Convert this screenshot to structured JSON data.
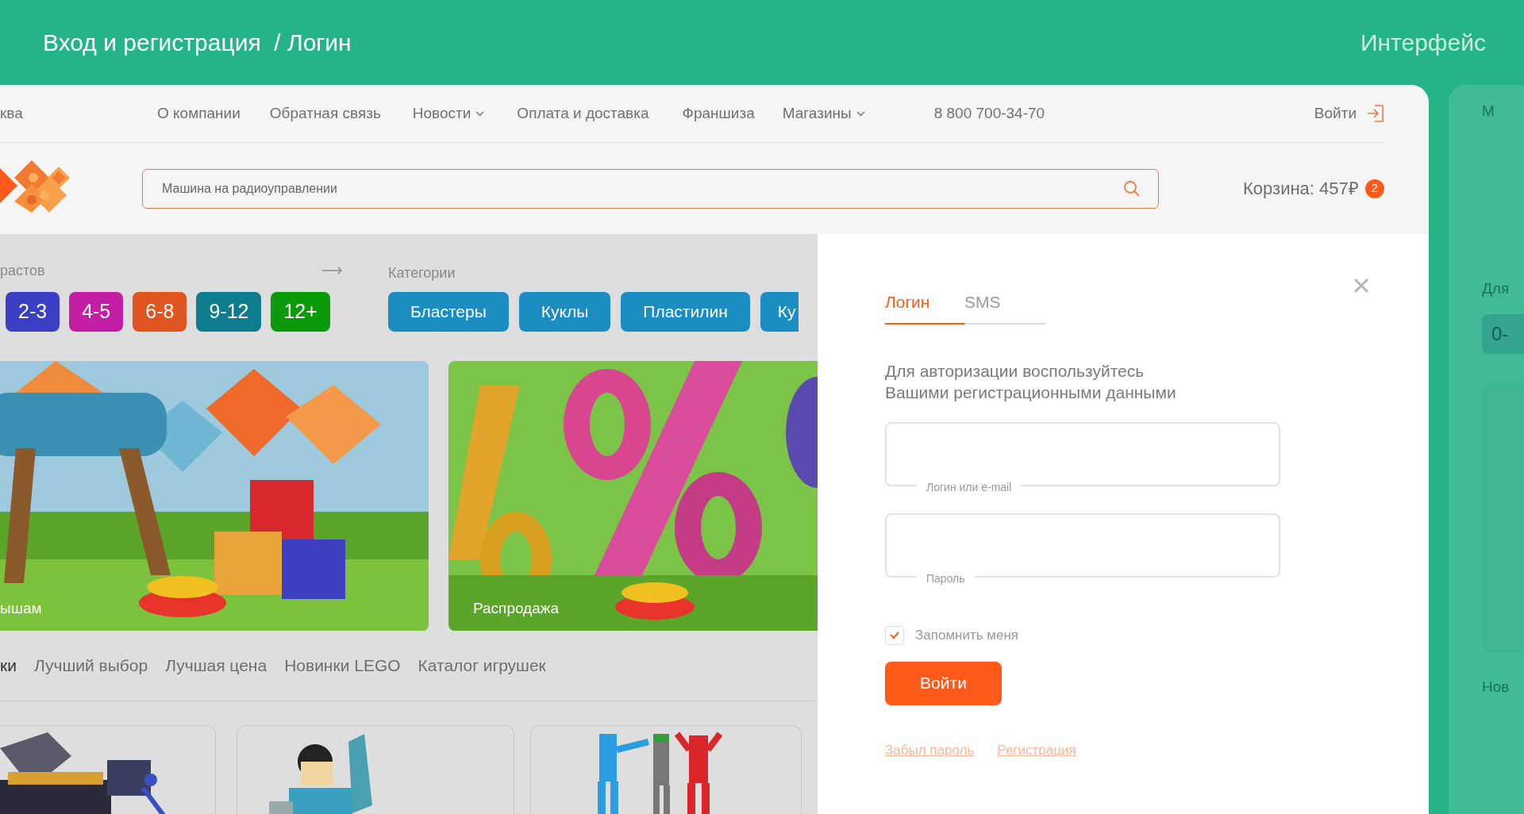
{
  "presentation": {
    "title": "Вход и регистрация  / Логин",
    "section": "Интерфейс"
  },
  "topbar": {
    "city": "ква",
    "links": [
      {
        "label": "О компании",
        "dropdown": false
      },
      {
        "label": "Обратная связь",
        "dropdown": false
      },
      {
        "label": "Новости",
        "dropdown": true
      },
      {
        "label": "Оплата и доставка",
        "dropdown": false
      },
      {
        "label": "Франшиза",
        "dropdown": false
      },
      {
        "label": "Магазины",
        "dropdown": true
      }
    ],
    "phone": "8 800 700-34-70",
    "login": "Войти"
  },
  "search": {
    "value": "Машина на радиоуправлении"
  },
  "cart": {
    "label": "Корзина: 457₽",
    "count": "2"
  },
  "ages": {
    "title": "растов",
    "items": [
      {
        "label": "2-3",
        "color": "#3b3fc4"
      },
      {
        "label": "4-5",
        "color": "#c21fa6"
      },
      {
        "label": "6-8",
        "color": "#e0541f"
      },
      {
        "label": "9-12",
        "color": "#0d7d8d"
      },
      {
        "label": "12+",
        "color": "#0a9a0a"
      }
    ]
  },
  "categories": {
    "title": "Категории",
    "items": [
      "Бластеры",
      "Куклы",
      "Пластилин",
      "Ку"
    ]
  },
  "banners": [
    {
      "label": "ышам",
      "kind": "picture"
    },
    {
      "label": "Распродажа",
      "kind": "picture"
    }
  ],
  "collections": [
    {
      "label": "ки",
      "selected": true
    },
    {
      "label": "Лучший выбор",
      "selected": false
    },
    {
      "label": "Лучшая цена",
      "selected": false
    },
    {
      "label": "Новинки LEGO",
      "selected": false
    },
    {
      "label": "Каталог игрушек",
      "selected": false
    }
  ],
  "login_modal": {
    "tabs": [
      {
        "label": "Логин",
        "selected": true
      },
      {
        "label": "SMS",
        "selected": false
      }
    ],
    "intro": "Для авторизации воспользуйтесь\nВашими регистрационными данными",
    "fields": [
      {
        "label": "Логин или e-mail"
      },
      {
        "label": "Пароль"
      }
    ],
    "remember": {
      "label": "Запомнить меня",
      "checked": true
    },
    "submit": "Войти",
    "links": [
      "Забыл пароль",
      "Регистрация"
    ]
  },
  "next_screen": {
    "city": "М",
    "ages_title": "Для",
    "age": "0-",
    "section": "Нов"
  }
}
